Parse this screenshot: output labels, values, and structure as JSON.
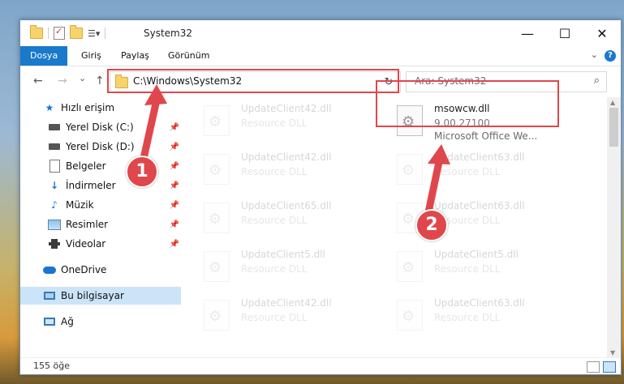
{
  "window": {
    "title": "System32",
    "minimize": "—",
    "maximize": "☐",
    "close": "✕"
  },
  "ribbon": {
    "tabs": [
      {
        "label": "Dosya",
        "active": true
      },
      {
        "label": "Giriş",
        "active": false
      },
      {
        "label": "Paylaş",
        "active": false
      },
      {
        "label": "Görünüm",
        "active": false
      }
    ],
    "help_label": "?"
  },
  "nav": {
    "back": "←",
    "forward": "→",
    "recent": "⌄",
    "up": "↑",
    "address": "C:\\Windows\\System32",
    "address_dropdown": "⌄",
    "refresh": "↻",
    "search_placeholder": "Ara: System32",
    "search_icon": "⌕"
  },
  "sidebar": {
    "items": [
      {
        "label": "Hızlı erişim",
        "icon": "star-icon"
      },
      {
        "label": "Yerel Disk (C:)",
        "icon": "drive-icon",
        "pinned": true
      },
      {
        "label": "Yerel Disk (D:)",
        "icon": "drive-icon",
        "pinned": true
      },
      {
        "label": "Belgeler",
        "icon": "document-icon",
        "pinned": true
      },
      {
        "label": "İndirmeler",
        "icon": "download-icon",
        "pinned": true
      },
      {
        "label": "Müzik",
        "icon": "music-icon",
        "pinned": true
      },
      {
        "label": "Resimler",
        "icon": "picture-icon",
        "pinned": true
      },
      {
        "label": "Videolar",
        "icon": "video-icon",
        "pinned": true
      },
      {
        "label": "OneDrive",
        "icon": "cloud-icon"
      },
      {
        "label": "Bu bilgisayar",
        "icon": "computer-icon",
        "selected": true
      },
      {
        "label": "Ağ",
        "icon": "network-icon"
      }
    ],
    "pin_glyph": "📌"
  },
  "files": {
    "left_column": [
      {
        "name": "UpdateClient42.dll",
        "desc": "Resource DLL"
      },
      {
        "name": "UpdateClient42.dll",
        "desc": "Resource DLL"
      },
      {
        "name": "UpdateClient65.dll",
        "desc": "Resource DLL"
      },
      {
        "name": "UpdateClient5.dll",
        "desc": "Resource DLL"
      },
      {
        "name": "UpdateClient42.dll",
        "desc": "Resource DLL"
      }
    ],
    "right_column": [
      {
        "name": "msowcw.dll",
        "desc": "9.00.27100",
        "desc2": "Microsoft Office We...",
        "highlight": true
      },
      {
        "name": "UpdateClient63.dll",
        "desc": "Resource DLL"
      },
      {
        "name": "UpdateClient63.dll",
        "desc": "Resource DLL"
      },
      {
        "name": "UpdateClient5.dll",
        "desc": "Resource DLL"
      },
      {
        "name": "UpdateClient63.dll",
        "desc": "Resource DLL"
      }
    ]
  },
  "status": {
    "item_count": "155 öğe"
  },
  "annotations": {
    "badge1": "1",
    "badge2": "2",
    "color": "#e0474c"
  }
}
